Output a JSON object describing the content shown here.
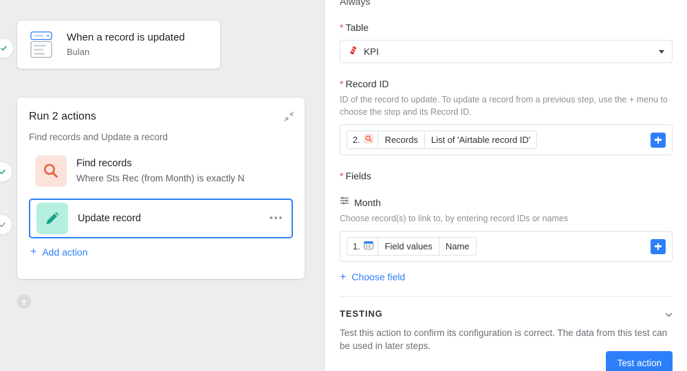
{
  "flow": {
    "trigger": {
      "icon": "record-select-icon",
      "title": "When a record is updated",
      "subtitle": "Bulan"
    },
    "actions_card": {
      "title": "Run 2 actions",
      "subtitle": "Find records and Update a record",
      "collapse_icon": "collapse-diagonal-icon",
      "rows": [
        {
          "icon": "magnifier-icon",
          "label": "Find records",
          "description": "Where Sts Rec (from Month) is exactly N",
          "selected": false
        },
        {
          "icon": "pencil-icon",
          "label": "Update record",
          "description": "",
          "selected": true,
          "more_icon": "ellipsis-icon"
        }
      ],
      "add_action_label": "Add action",
      "add_action_icon": "plus-icon"
    },
    "flow_plus_icon": "plus-circle-icon",
    "edge_badges": [
      {
        "icon": "check-circle-icon"
      },
      {
        "icon": "check-circle-icon"
      },
      {
        "icon": "check-circle-icon"
      }
    ]
  },
  "panel": {
    "condition_label": "Always",
    "table": {
      "label": "Table",
      "required_mark": "*",
      "icon": "red-rocket-icon",
      "value": "KPI",
      "caret_icon": "chevron-down-icon"
    },
    "record_id": {
      "label": "Record ID",
      "required_mark": "*",
      "helper": "ID of the record to update. To update a record from a previous step, use the + menu to choose the step and its Record ID.",
      "chip": {
        "index": "2.",
        "icon": "magnifier-token-icon",
        "source": "Records",
        "value": "List of 'Airtable record ID'"
      },
      "add_icon": "plus-square-icon"
    },
    "fields": {
      "label": "Fields",
      "required_mark": "*",
      "field_name": "Month",
      "field_icon": "link-records-icon",
      "helper": "Choose record(s) to link to, by entering record IDs or names",
      "chip": {
        "index": "1.",
        "icon": "calendar-token-icon",
        "source": "Field values",
        "value": "Name"
      },
      "add_icon": "plus-square-icon",
      "choose_field_label": "Choose field",
      "choose_field_icon": "plus-icon"
    },
    "testing": {
      "heading": "TESTING",
      "chevron_icon": "chevron-down-icon",
      "description": "Test this action to confirm its configuration is correct. The data from this test can be used in later steps.",
      "button_label": "Test action"
    }
  },
  "colors": {
    "accent_blue": "#2d7ff9",
    "canvas_gray": "#eceded",
    "find_icon_bg": "#fbe3dc",
    "find_icon_fg": "#e8603c",
    "update_icon_bg": "#b5efdf",
    "update_icon_fg": "#17a08a",
    "required_red": "#d94c53",
    "kpi_icon_red": "#e3342f"
  }
}
